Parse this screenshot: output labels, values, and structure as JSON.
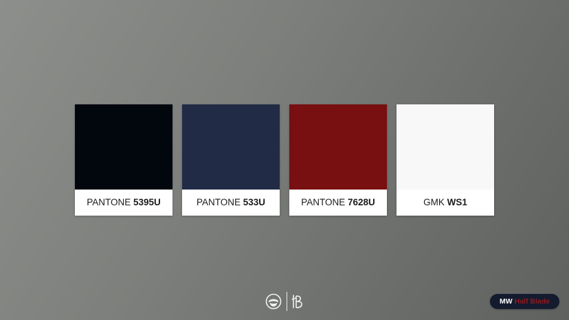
{
  "swatches": [
    {
      "prefix": "PANTONE",
      "code": "5395U",
      "color": "#02060d"
    },
    {
      "prefix": "PANTONE",
      "code": "533U",
      "color": "#222b45"
    },
    {
      "prefix": "PANTONE",
      "code": "7628U",
      "color": "#780f11"
    },
    {
      "prefix": "GMK",
      "code": "WS1",
      "color": "#f8f8f8"
    }
  ],
  "badge": {
    "prefix": "MW",
    "name": "Half Blade",
    "background": "#151b2e",
    "accent": "#8e1a1f"
  },
  "logos": {
    "left_icon": "ninja-mask-icon",
    "right_icon": "hb-monogram-icon"
  }
}
